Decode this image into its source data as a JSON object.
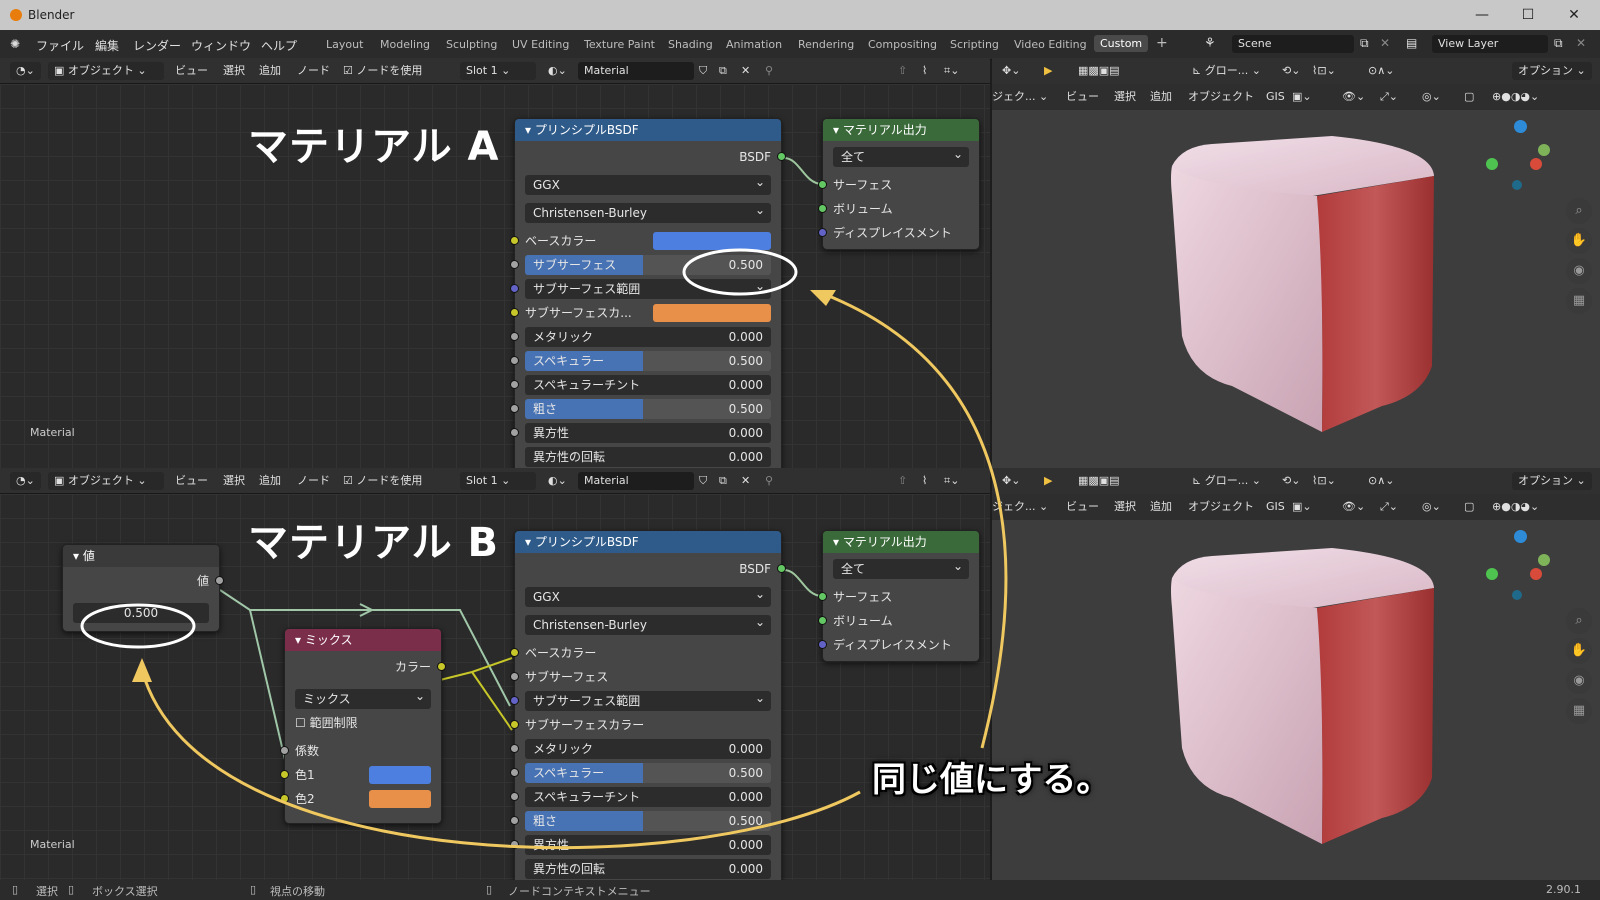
{
  "window": {
    "title": "Blender"
  },
  "menu": [
    "ファイル",
    "編集",
    "レンダー",
    "ウィンドウ",
    "ヘルプ"
  ],
  "workspaces": [
    "Layout",
    "Modeling",
    "Sculpting",
    "UV Editing",
    "Texture Paint",
    "Shading",
    "Animation",
    "Rendering",
    "Compositing",
    "Scripting",
    "Video Editing",
    "Custom"
  ],
  "scene": "Scene",
  "view_layer": "View Layer",
  "node_header": {
    "mode": "オブジェクト",
    "view": "ビュー",
    "select": "選択",
    "add": "追加",
    "node": "ノード",
    "use_nodes": "ノードを使用",
    "slot": "Slot 1",
    "material": "Material"
  },
  "viewport_header": {
    "orientation": "グロー...",
    "options": "オプション",
    "object_mode": "ジェク...",
    "view": "ビュー",
    "select": "選択",
    "add": "追加",
    "object": "オブジェクト",
    "gis": "GIS"
  },
  "top": {
    "big_label": "マテリアル A",
    "editor_label": "Material",
    "bsdf": {
      "title": "プリンシプルBSDF",
      "out": "BSDF",
      "dist": "GGX",
      "ss_method": "Christensen-Burley",
      "base_color": "ベースカラー",
      "subsurface": {
        "label": "サブサーフェス",
        "value": "0.500"
      },
      "subsurface_radius": "サブサーフェス範囲",
      "subsurface_color": "サブサーフェスカ...",
      "metallic": {
        "label": "メタリック",
        "value": "0.000"
      },
      "specular": {
        "label": "スペキュラー",
        "value": "0.500"
      },
      "specular_tint": {
        "label": "スペキュラーチント",
        "value": "0.000"
      },
      "roughness": {
        "label": "粗さ",
        "value": "0.500"
      },
      "anisotropic": {
        "label": "異方性",
        "value": "0.000"
      },
      "anisotropic_rot": {
        "label": "異方性の回転",
        "value": "0.000"
      }
    },
    "output": {
      "title": "マテリアル出力",
      "target": "全て",
      "surface": "サーフェス",
      "volume": "ボリューム",
      "displacement": "ディスプレイスメント"
    }
  },
  "bottom": {
    "big_label": "マテリアル B",
    "editor_label": "Material",
    "value_node": {
      "title": "値",
      "out": "値",
      "value": "0.500"
    },
    "mix_node": {
      "title": "ミックス",
      "out": "カラー",
      "blend": "ミックス",
      "clamp": "範囲制限",
      "fac": "係数",
      "c1": "色1",
      "c2": "色2"
    },
    "bsdf": {
      "title": "プリンシプルBSDF",
      "out": "BSDF",
      "dist": "GGX",
      "ss_method": "Christensen-Burley",
      "base_color": "ベースカラー",
      "subsurface": "サブサーフェス",
      "subsurface_radius": "サブサーフェス範囲",
      "subsurface_color": "サブサーフェスカラー",
      "metallic": {
        "label": "メタリック",
        "value": "0.000"
      },
      "specular": {
        "label": "スペキュラー",
        "value": "0.500"
      },
      "specular_tint": {
        "label": "スペキュラーチント",
        "value": "0.000"
      },
      "roughness": {
        "label": "粗さ",
        "value": "0.500"
      },
      "anisotropic": {
        "label": "異方性",
        "value": "0.000"
      },
      "anisotropic_rot": {
        "label": "異方性の回転",
        "value": "0.000"
      }
    },
    "output": {
      "title": "マテリアル出力",
      "target": "全て",
      "surface": "サーフェス",
      "volume": "ボリューム",
      "displacement": "ディスプレイスメント"
    }
  },
  "annotation": "同じ値にする。",
  "status": {
    "select": "選択",
    "box_select": "ボックス選択",
    "pan": "視点の移動",
    "context_menu": "ノードコンテキストメニュー",
    "version": "2.90.1"
  },
  "colors": {
    "base_blue": "#4d7fe0",
    "ss_orange": "#e8904a",
    "annot_yellow": "#f0c860"
  }
}
